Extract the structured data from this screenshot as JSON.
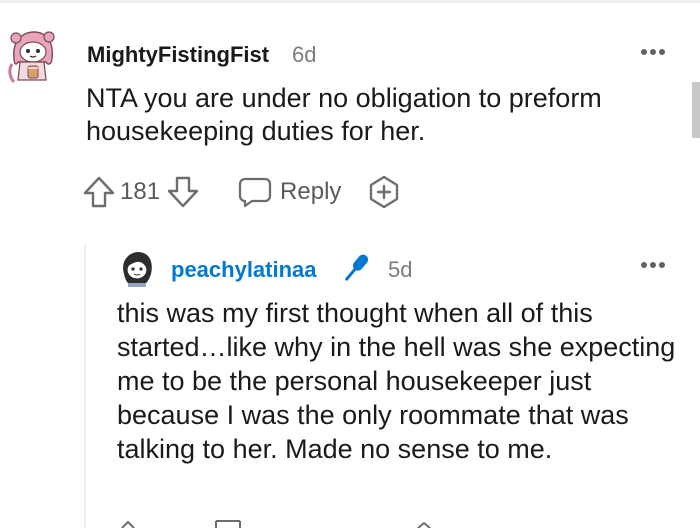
{
  "comment": {
    "username": "MightyFistingFist",
    "time": "6d",
    "body": "NTA you are under no obligation to preform housekeeping duties for her.",
    "votes": "181",
    "reply_label": "Reply",
    "more_label": "•••"
  },
  "reply": {
    "username": "peachylatinaa",
    "time": "5d",
    "body": "this was my first thought when all of this started…like why in the hell was she expecting me to be the personal housekeeper just because I was the only roommate that was talking to her. Made no sense to me.",
    "more_label": "•••"
  },
  "colors": {
    "op_accent": "#0079d3",
    "text": "#1a1a1b",
    "meta": "#7c7c7c",
    "icon": "#878a8c"
  },
  "icons": {
    "avatar_1": "snoo-avatar-icon",
    "avatar_2": "snoo-avatar-icon",
    "op_badge": "microphone-icon",
    "upvote": "upvote-arrow-icon",
    "downvote": "downvote-arrow-icon",
    "reply": "speech-bubble-icon",
    "award": "award-plus-icon",
    "more": "more-options-icon"
  }
}
